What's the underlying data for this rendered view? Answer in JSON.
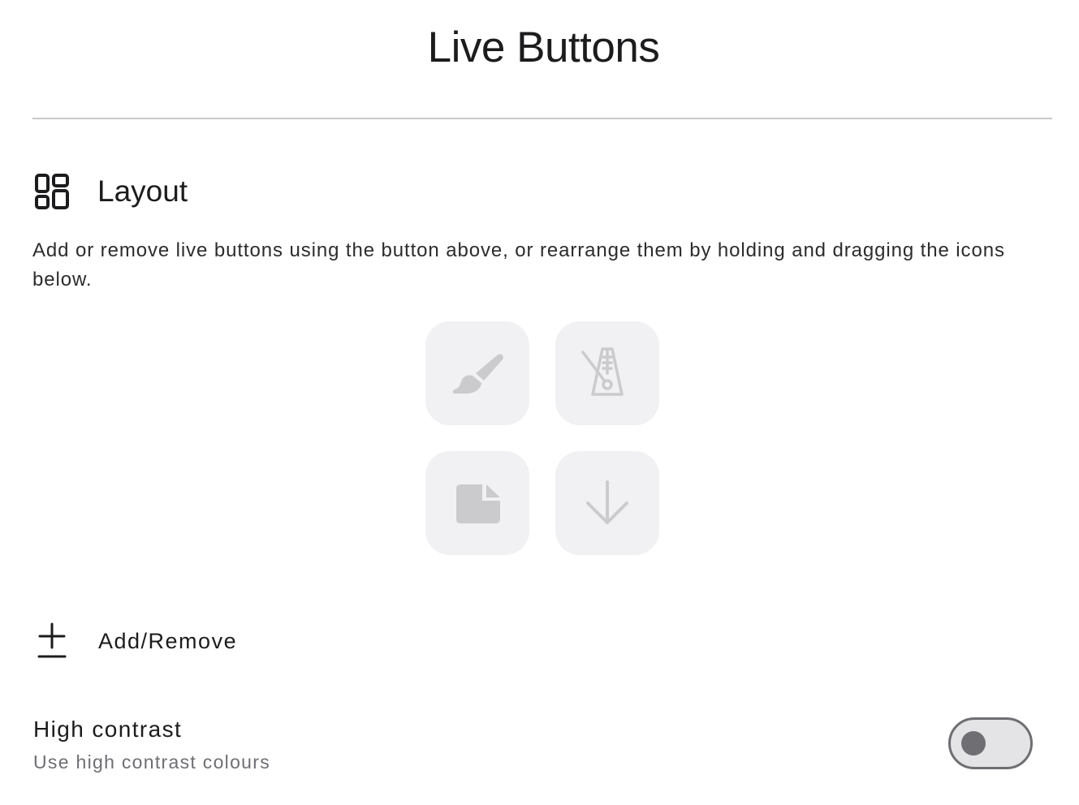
{
  "header": {
    "title": "Live Buttons"
  },
  "layout_section": {
    "icon": "layout-grid-icon",
    "title": "Layout",
    "description": "Add or remove live buttons using the button above, or rearrange them by holding and dragging the icons below.",
    "tiles": [
      {
        "icon": "paintbrush-icon"
      },
      {
        "icon": "metronome-off-icon"
      },
      {
        "icon": "note-icon"
      },
      {
        "icon": "arrow-down-icon"
      }
    ]
  },
  "add_remove": {
    "icon": "plus-icon",
    "label": "Add/Remove"
  },
  "high_contrast": {
    "title": "High contrast",
    "subtitle": "Use high contrast colours",
    "enabled": false
  },
  "colors": {
    "tile_background": "#f1f1f3",
    "tile_icon": "#cbcbce",
    "toggle_track": "#e4e4e7",
    "toggle_border": "#6e6e73",
    "divider": "#c8c8cc"
  }
}
